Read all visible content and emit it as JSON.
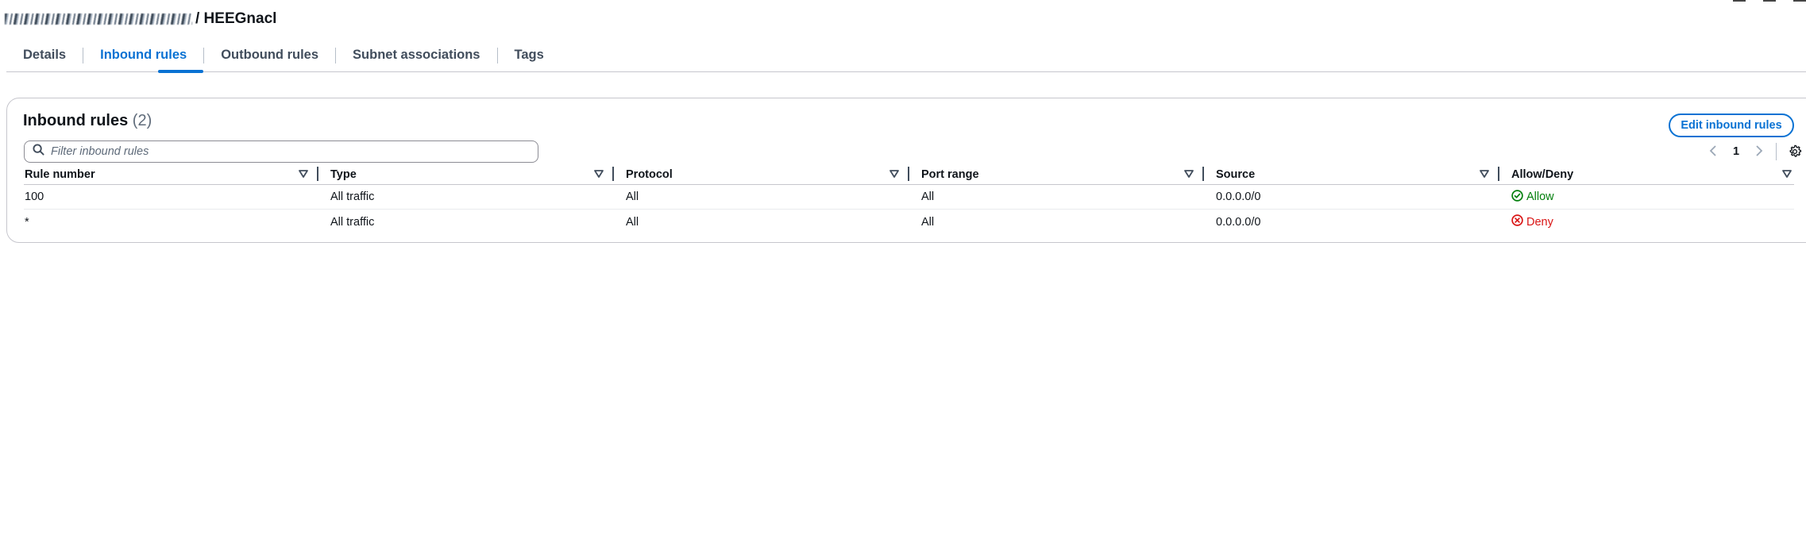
{
  "header": {
    "breadcrumb_obscured": "redacted breadcrumb",
    "title": "/ HEEGnacl"
  },
  "tabs": [
    {
      "label": "Details",
      "active": false
    },
    {
      "label": "Inbound rules",
      "active": true
    },
    {
      "label": "Outbound rules",
      "active": false
    },
    {
      "label": "Subnet associations",
      "active": false
    },
    {
      "label": "Tags",
      "active": false
    }
  ],
  "panel": {
    "title": "Inbound rules",
    "count": "(2)",
    "edit_button": "Edit inbound rules",
    "filter_placeholder": "Filter inbound rules",
    "pagination": {
      "current_page": "1",
      "prev_icon": "chevron-left-icon",
      "next_icon": "chevron-right-icon"
    },
    "settings_icon": "gear-icon"
  },
  "table": {
    "columns": [
      "Rule number",
      "Type",
      "Protocol",
      "Port range",
      "Source",
      "Allow/Deny"
    ],
    "rows": [
      {
        "rule_number": "100",
        "type": "All traffic",
        "protocol": "All",
        "port_range": "All",
        "source": "0.0.0.0/0",
        "action": "Allow",
        "action_icon": "check-circle-icon"
      },
      {
        "rule_number": "*",
        "type": "All traffic",
        "protocol": "All",
        "port_range": "All",
        "source": "0.0.0.0/0",
        "action": "Deny",
        "action_icon": "x-circle-icon"
      }
    ]
  },
  "colors": {
    "accent": "#0972d3",
    "allow": "#037f0c",
    "deny": "#d91515",
    "text": "#0f141a",
    "muted": "#5f6b7a"
  }
}
